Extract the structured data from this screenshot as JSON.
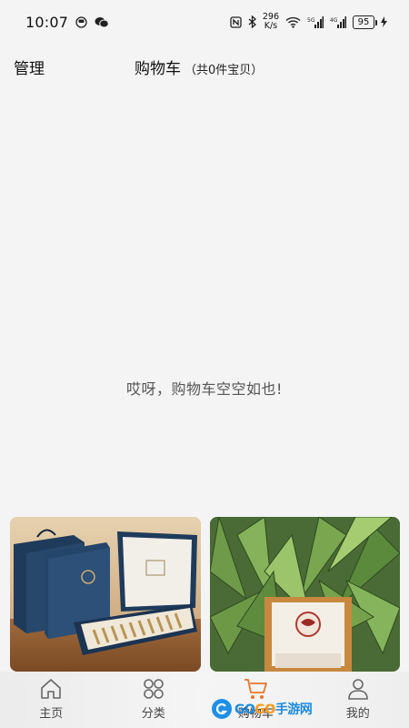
{
  "status_bar": {
    "time": "10:07",
    "net_speed_value": "296",
    "net_speed_unit": "K/s",
    "battery": "95"
  },
  "header": {
    "manage_label": "管理",
    "title": "购物车",
    "count_text": "（共0件宝贝）"
  },
  "empty_message": "哎呀，购物车空空如也!",
  "tabs": [
    {
      "label": "主页",
      "icon": "home-icon"
    },
    {
      "label": "分类",
      "icon": "category-icon"
    },
    {
      "label": "购物车",
      "icon": "cart-icon"
    },
    {
      "label": "我的",
      "icon": "profile-icon"
    }
  ],
  "watermark": {
    "brand_a": "GO",
    "brand_b": "GO",
    "brand_c": "手游网"
  },
  "colors": {
    "background": "#f4f4f4",
    "accent": "#e8772e"
  }
}
